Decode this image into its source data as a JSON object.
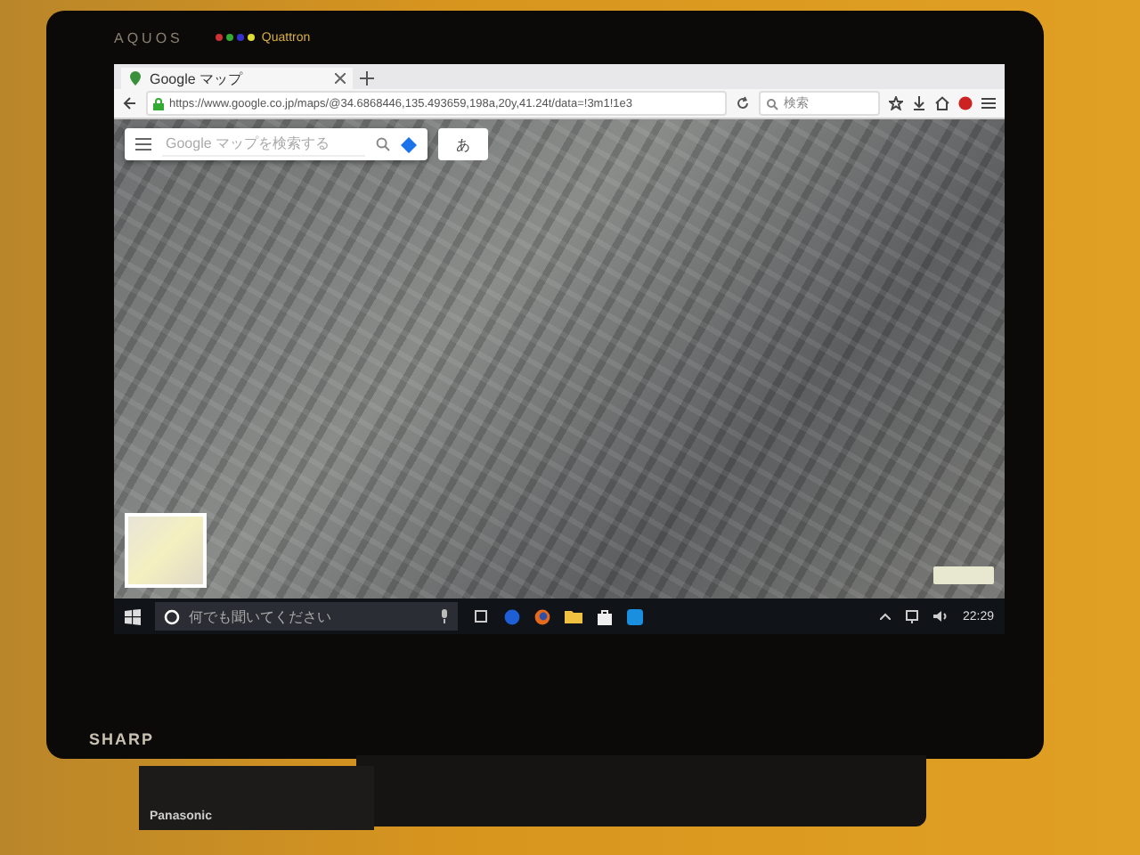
{
  "tv": {
    "brand_top": "AQUOS",
    "badge": "Quattron",
    "brand_bottom": "SHARP"
  },
  "browser": {
    "tab_title": "Google マップ",
    "url": "https://www.google.co.jp/maps/@34.6868446,135.493659,198a,20y,41.24t/data=!3m1!1e3",
    "search_placeholder": "検索",
    "maps_search_placeholder": "Google マップを検索する",
    "input_mode": "あ"
  },
  "taskbar": {
    "cortana_placeholder": "何でも聞いてください",
    "time": "22:29"
  },
  "receiver": {
    "brand": "Panasonic"
  }
}
